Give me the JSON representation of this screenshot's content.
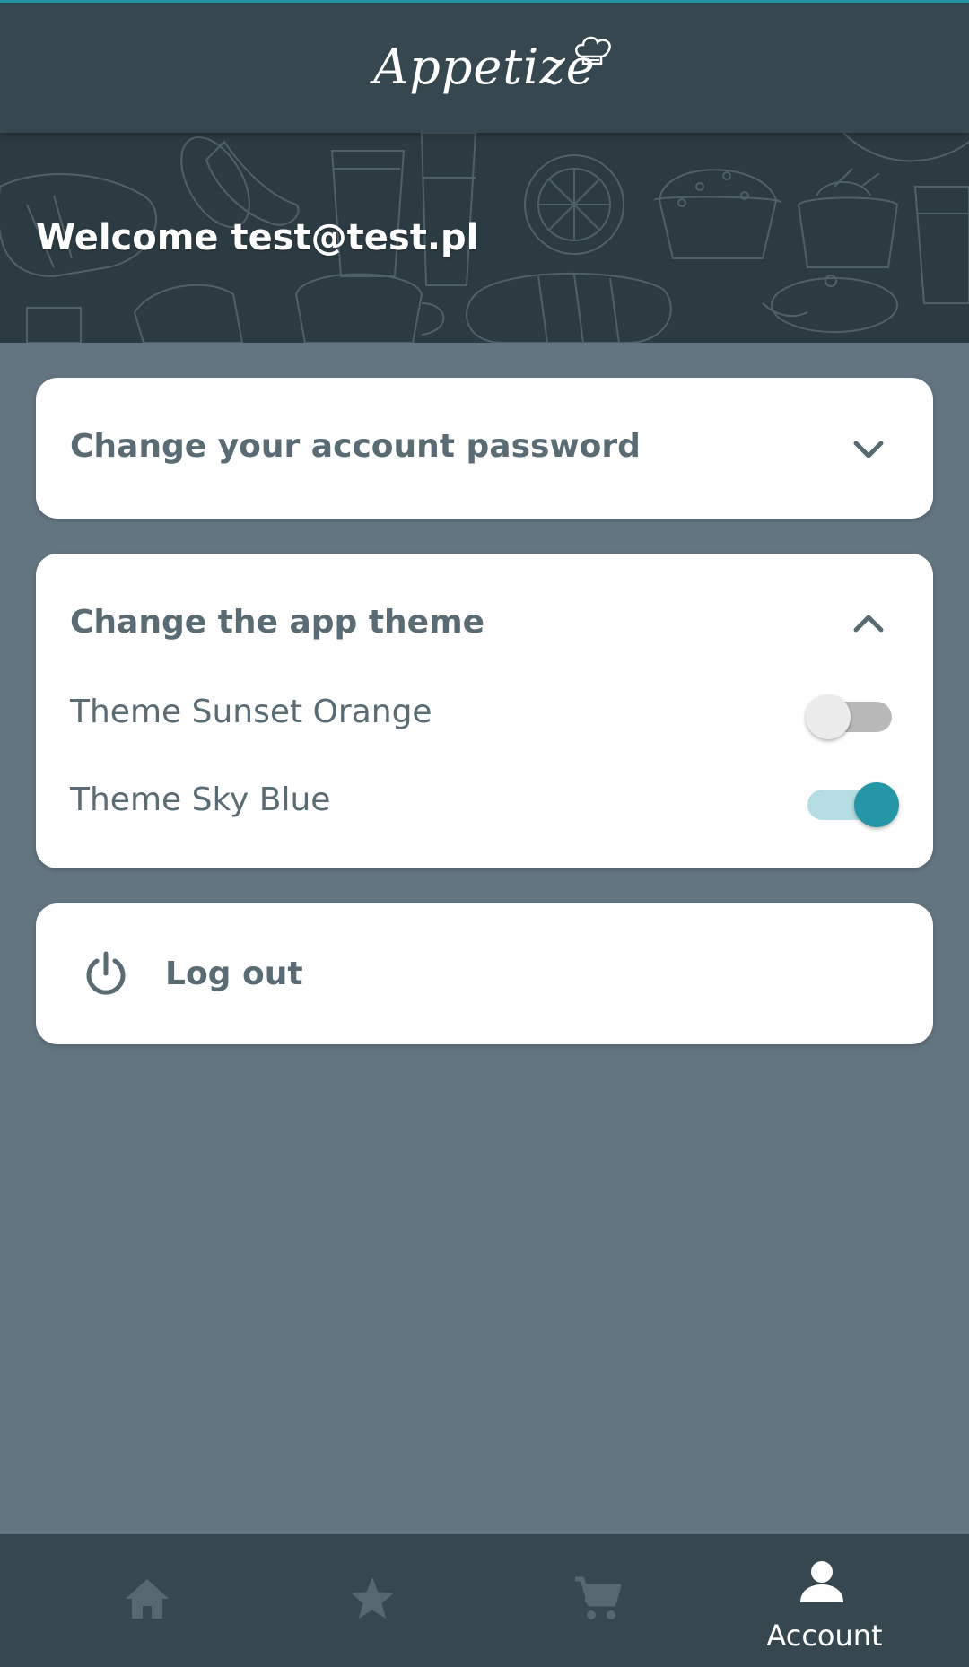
{
  "app": {
    "logo_text": "Appetize"
  },
  "banner": {
    "welcome_text": "Welcome test@test.pl"
  },
  "password_section": {
    "title": "Change your account password",
    "expanded": false
  },
  "theme_section": {
    "title": "Change the app theme",
    "expanded": true,
    "options": [
      {
        "label": "Theme Sunset Orange",
        "enabled": false
      },
      {
        "label": "Theme Sky Blue",
        "enabled": true
      }
    ]
  },
  "logout": {
    "label": "Log out"
  },
  "bottom_nav": {
    "items": [
      {
        "icon": "home-icon",
        "label": "",
        "active": false
      },
      {
        "icon": "star-icon",
        "label": "",
        "active": false
      },
      {
        "icon": "cart-icon",
        "label": "",
        "active": false
      },
      {
        "icon": "account-icon",
        "label": "Account",
        "active": true
      }
    ]
  },
  "colors": {
    "app_bar": "#37474f",
    "background": "#637580",
    "accent": "#2596a6",
    "card": "#ffffff",
    "text": "#5b6b74"
  }
}
